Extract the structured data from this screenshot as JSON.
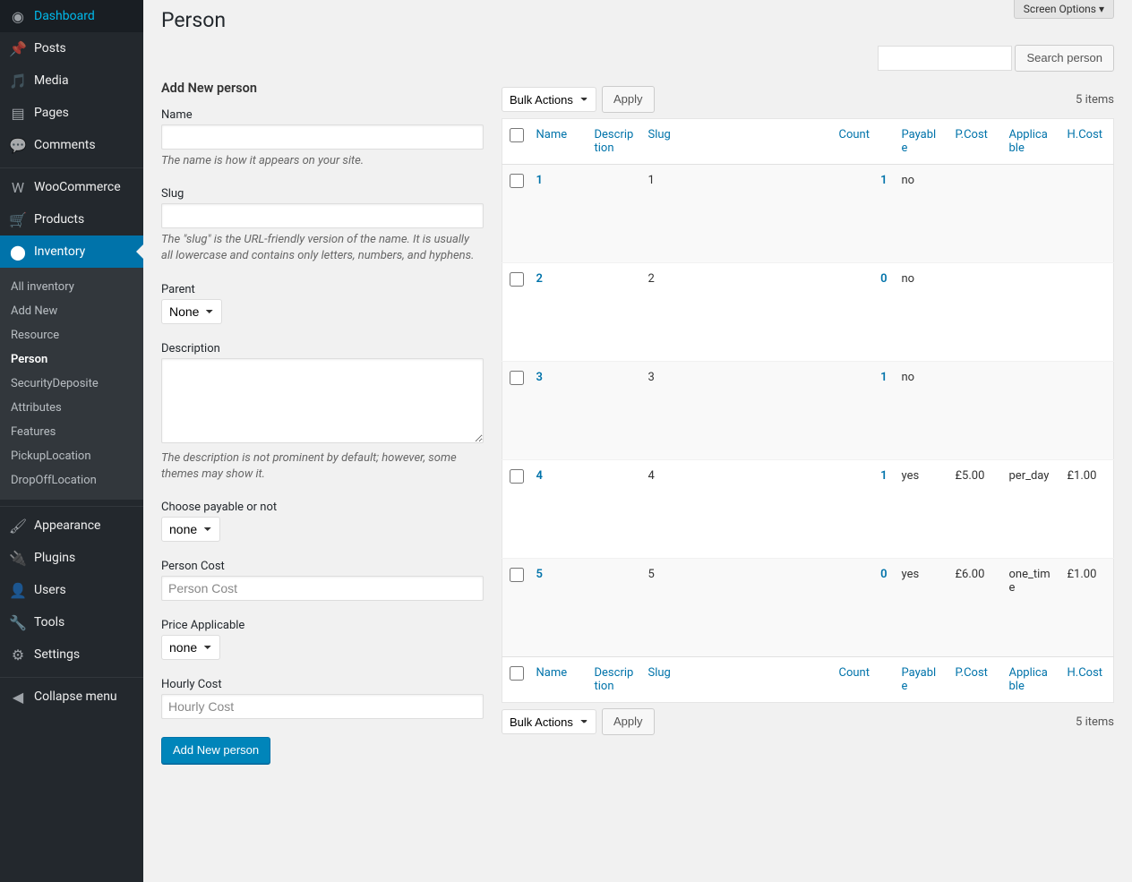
{
  "screen_options": "Screen Options ▾",
  "page_title": "Person",
  "search": {
    "button": "Search person"
  },
  "sidebar": {
    "items": [
      {
        "label": "Dashboard",
        "icon": "dashboard-icon"
      },
      {
        "label": "Posts",
        "icon": "pin-icon"
      },
      {
        "label": "Media",
        "icon": "media-icon"
      },
      {
        "label": "Pages",
        "icon": "page-icon"
      },
      {
        "label": "Comments",
        "icon": "comment-icon"
      },
      {
        "label": "WooCommerce",
        "icon": "woo-icon"
      },
      {
        "label": "Products",
        "icon": "cart-icon"
      },
      {
        "label": "Inventory",
        "icon": "inventory-icon",
        "current": true
      },
      {
        "label": "Appearance",
        "icon": "brush-icon"
      },
      {
        "label": "Plugins",
        "icon": "plug-icon"
      },
      {
        "label": "Users",
        "icon": "user-icon"
      },
      {
        "label": "Tools",
        "icon": "wrench-icon"
      },
      {
        "label": "Settings",
        "icon": "settings-icon"
      },
      {
        "label": "Collapse menu",
        "icon": "collapse-icon"
      }
    ],
    "submenu": [
      "All inventory",
      "Add New",
      "Resource",
      "Person",
      "SecurityDeposite",
      "Attributes",
      "Features",
      "PickupLocation",
      "DropOffLocation"
    ],
    "submenu_current": "Person"
  },
  "form": {
    "title": "Add New person",
    "name_label": "Name",
    "name_hint": "The name is how it appears on your site.",
    "slug_label": "Slug",
    "slug_hint": "The \"slug\" is the URL-friendly version of the name. It is usually all lowercase and contains only letters, numbers, and hyphens.",
    "parent_label": "Parent",
    "parent_value": "None",
    "desc_label": "Description",
    "desc_hint": "The description is not prominent by default; however, some themes may show it.",
    "payable_label": "Choose payable or not",
    "payable_value": "none",
    "pcost_label": "Person Cost",
    "pcost_placeholder": "Person Cost",
    "applicable_label": "Price Applicable",
    "applicable_value": "none",
    "hcost_label": "Hourly Cost",
    "hcost_placeholder": "Hourly Cost",
    "submit": "Add New person"
  },
  "bulk": {
    "label": "Bulk Actions",
    "apply": "Apply"
  },
  "item_count": "5 items",
  "columns": {
    "name": "Name",
    "desc": "Description",
    "slug": "Slug",
    "count": "Count",
    "payable": "Payable",
    "pcost": "P.Cost",
    "app": "Applicable",
    "hcost": "H.Cost"
  },
  "rows": [
    {
      "name": "1",
      "slug": "1",
      "count": "1",
      "payable": "no",
      "pcost": "",
      "app": "",
      "hcost": ""
    },
    {
      "name": "2",
      "slug": "2",
      "count": "0",
      "payable": "no",
      "pcost": "",
      "app": "",
      "hcost": ""
    },
    {
      "name": "3",
      "slug": "3",
      "count": "1",
      "payable": "no",
      "pcost": "",
      "app": "",
      "hcost": ""
    },
    {
      "name": "4",
      "slug": "4",
      "count": "1",
      "payable": "yes",
      "pcost": "£5.00",
      "app": "per_day",
      "hcost": "£1.00"
    },
    {
      "name": "5",
      "slug": "5",
      "count": "0",
      "payable": "yes",
      "pcost": "£6.00",
      "app": "one_time",
      "hcost": "£1.00"
    }
  ],
  "icons": {
    "dashboard-icon": "◉",
    "pin-icon": "📌",
    "media-icon": "🎵",
    "page-icon": "▤",
    "comment-icon": "💬",
    "woo-icon": "W",
    "cart-icon": "🛒",
    "inventory-icon": "⬤",
    "brush-icon": "🖌",
    "plug-icon": "🔌",
    "user-icon": "👤",
    "wrench-icon": "🔧",
    "settings-icon": "⚙",
    "collapse-icon": "◀"
  }
}
